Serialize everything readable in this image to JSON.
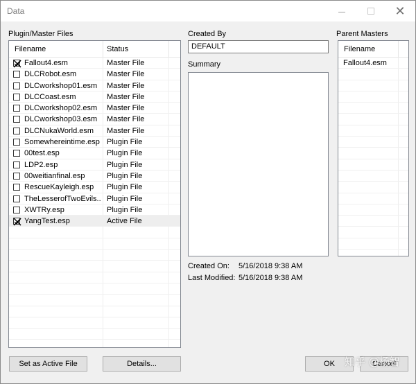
{
  "window": {
    "title": "Data"
  },
  "plugins": {
    "group_label": "Plugin/Master Files",
    "columns": [
      "Filename",
      "Status"
    ],
    "rows": [
      {
        "filename": "Fallout4.esm",
        "status": "Master File",
        "checked": true
      },
      {
        "filename": "DLCRobot.esm",
        "status": "Master File",
        "checked": false
      },
      {
        "filename": "DLCworkshop01.esm",
        "status": "Master File",
        "checked": false
      },
      {
        "filename": "DLCCoast.esm",
        "status": "Master File",
        "checked": false
      },
      {
        "filename": "DLCworkshop02.esm",
        "status": "Master File",
        "checked": false
      },
      {
        "filename": "DLCworkshop03.esm",
        "status": "Master File",
        "checked": false
      },
      {
        "filename": "DLCNukaWorld.esm",
        "status": "Master File",
        "checked": false
      },
      {
        "filename": "Somewhereintime.esp",
        "status": "Plugin File",
        "checked": false
      },
      {
        "filename": "00test.esp",
        "status": "Plugin File",
        "checked": false
      },
      {
        "filename": "LDP2.esp",
        "status": "Plugin File",
        "checked": false
      },
      {
        "filename": "00weitianfinal.esp",
        "status": "Plugin File",
        "checked": false
      },
      {
        "filename": "RescueKayleigh.esp",
        "status": "Plugin File",
        "checked": false
      },
      {
        "filename": "TheLesserofTwoEvils....",
        "status": "Plugin File",
        "checked": false
      },
      {
        "filename": "XWTRy.esp",
        "status": "Plugin File",
        "checked": false
      },
      {
        "filename": "YangTest.esp",
        "status": "Active File",
        "checked": true,
        "selected": true
      }
    ]
  },
  "created_by": {
    "label": "Created By",
    "value": "DEFAULT"
  },
  "summary": {
    "label": "Summary"
  },
  "parent_masters": {
    "label": "Parent Masters",
    "column": "Filename",
    "rows": [
      "Fallout4.esm"
    ]
  },
  "created_on": {
    "label": "Created On:",
    "value": "5/16/2018  9:38 AM"
  },
  "last_modified": {
    "label": "Last Modified:",
    "value": "5/16/2018  9:38 AM"
  },
  "buttons": {
    "set_active": "Set as Active File",
    "details": "Details...",
    "ok": "OK",
    "cancel": "Cancel"
  },
  "watermark": "知乎 @杨智"
}
